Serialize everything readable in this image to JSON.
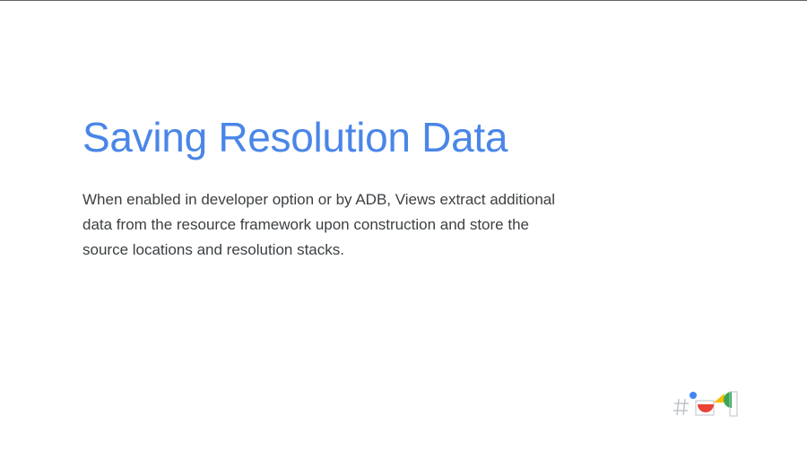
{
  "slide": {
    "title": "Saving Resolution Data",
    "body_lines": [
      "When enabled in developer option or by ADB, Views extract additional",
      "data from the resource framework upon construction and store the",
      "source locations and resolution stacks."
    ]
  },
  "logo": {
    "icon": "google-io-hashtag-logo-icon"
  },
  "colors": {
    "title": "#4a86e8",
    "body": "#3c4043",
    "top_rule": "#5f6368",
    "background": "#ffffff",
    "logo_blue": "#4285f4",
    "logo_red": "#ea4335",
    "logo_yellow": "#fbbc04",
    "logo_green": "#34a853",
    "logo_gray": "#bdc1c6"
  }
}
